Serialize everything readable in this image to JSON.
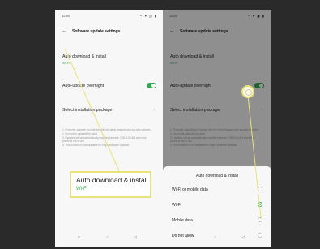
{
  "left_phone": {
    "status_time": "11:39",
    "status_icons": "⚬ ▾ ◨ ▮",
    "header_title": "Software update settings",
    "auto_download": {
      "label": "Auto download & install",
      "value": "Wi-Fi"
    },
    "auto_update_overnight": {
      "label": "Auto-update overnight",
      "enabled": true
    },
    "select_package": {
      "label": "Select installation package"
    },
    "notes": [
      "1. Promptly upgrade your device with the latest features and security patches.",
      "2. No mobile data will be used.",
      "3. Updates will be automatically installed between 2:00-5:00 AM when the phone is not in use.",
      "4. This function is not available for major software updates."
    ],
    "nav": {
      "menu": "≡",
      "home": "○",
      "back": "◁"
    }
  },
  "callout": {
    "label": "Auto download & install",
    "value": "Wi-Fi"
  },
  "right_phone": {
    "status_time": "11:39",
    "status_icons": "⚬ ▾ ◨ ▮",
    "header_title": "Software update settings",
    "auto_download": {
      "label": "Auto download & install",
      "value": "Wi-Fi"
    },
    "auto_update_overnight": {
      "label": "Auto-update overnight",
      "enabled": true
    },
    "select_package": {
      "label": "Select installation package"
    },
    "notes": [
      "1. Promptly upgrade your device with the latest features and security patches.",
      "2. No mobile data will be used.",
      "3. Updates will be automatically installed between 2:00-5:00 AM when the phone is not in use.",
      "4. This function is not available for major software updates."
    ],
    "sheet": {
      "title": "Auto download & install",
      "options": [
        {
          "label": "Wi-Fi or mobile data",
          "selected": false
        },
        {
          "label": "Wi-Fi",
          "selected": true
        },
        {
          "label": "Mobile data",
          "selected": false
        },
        {
          "label": "Do not allow",
          "selected": false
        }
      ]
    },
    "nav": {
      "menu": "≡",
      "home": "○",
      "back": "◁"
    }
  },
  "colors": {
    "accent_green": "#2fa84f",
    "highlight_yellow": "#e8e27a",
    "background": "#2a2a2a"
  }
}
